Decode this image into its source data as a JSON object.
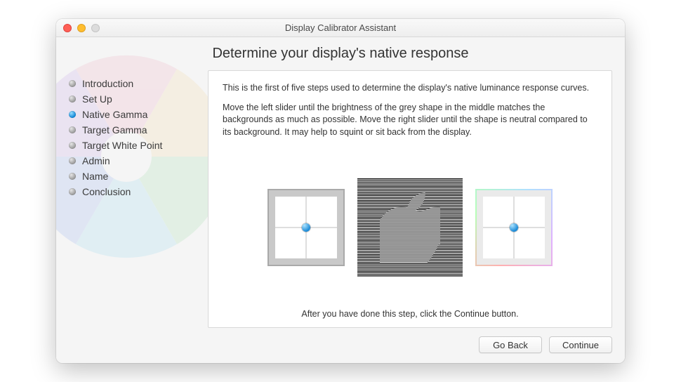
{
  "window": {
    "title": "Display Calibrator Assistant"
  },
  "heading": "Determine your display's native response",
  "sidebar": {
    "items": [
      {
        "label": "Introduction",
        "current": false
      },
      {
        "label": "Set Up",
        "current": false
      },
      {
        "label": "Native Gamma",
        "current": true
      },
      {
        "label": "Target Gamma",
        "current": false
      },
      {
        "label": "Target White Point",
        "current": false
      },
      {
        "label": "Admin",
        "current": false
      },
      {
        "label": "Name",
        "current": false
      },
      {
        "label": "Conclusion",
        "current": false
      }
    ]
  },
  "main": {
    "paragraph1": "This is the first of five steps used to determine the display's native luminance response curves.",
    "paragraph2": "Move the left slider until the brightness of the grey shape in the middle matches the backgrounds as much as possible.  Move the right slider until the shape is neutral compared to its background.  It may help to squint or sit back from the display.",
    "footer": "After you have done this step, click the Continue button."
  },
  "buttons": {
    "back": "Go Back",
    "continue": "Continue"
  }
}
